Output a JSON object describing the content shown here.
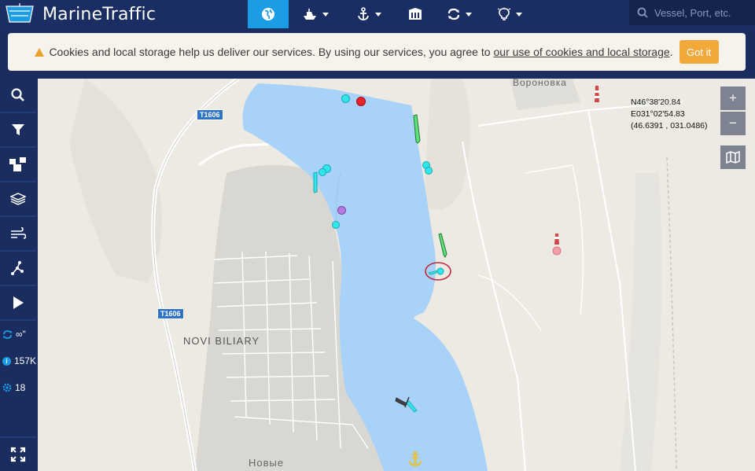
{
  "app": {
    "title": "MarineTraffic"
  },
  "nav": {
    "items": [
      {
        "id": "live-map",
        "icon": "globe-icon",
        "active": true,
        "caret": false
      },
      {
        "id": "ships",
        "icon": "ship-icon",
        "active": false,
        "caret": true
      },
      {
        "id": "ports",
        "icon": "anchor-icon",
        "active": false,
        "caret": true
      },
      {
        "id": "services",
        "icon": "building-icon",
        "active": false,
        "caret": false
      },
      {
        "id": "sync",
        "icon": "sync-icon",
        "active": false,
        "caret": true
      },
      {
        "id": "ideas",
        "icon": "lightbulb-icon",
        "active": false,
        "caret": true
      }
    ]
  },
  "search": {
    "placeholder": "Vessel, Port, etc."
  },
  "cookie": {
    "text": "Cookies and local storage help us deliver our services. By using our services, you agree to",
    "link": "our use of cookies and local storage",
    "end": ".",
    "button": "Got it"
  },
  "sidebar": {
    "buttons": [
      {
        "id": "search",
        "icon": "search-icon"
      },
      {
        "id": "filters",
        "icon": "filter-icon"
      },
      {
        "id": "fleets",
        "icon": "fleet-icon"
      },
      {
        "id": "layers",
        "icon": "layers-icon"
      },
      {
        "id": "weather",
        "icon": "wind-icon"
      },
      {
        "id": "measure",
        "icon": "measure-icon"
      },
      {
        "id": "playback",
        "icon": "play-icon"
      }
    ],
    "stats": [
      {
        "id": "refresh",
        "icon": "refresh-icon",
        "value": "∞\""
      },
      {
        "id": "vessels",
        "icon": "info-icon",
        "value": "157K"
      },
      {
        "id": "nearby",
        "icon": "gear-icon",
        "value": "18"
      }
    ],
    "fullscreen_icon": "fullscreen-icon"
  },
  "map": {
    "labels": {
      "voronovka": "Вороновка",
      "novi_biliary": "NOVI BILIARY",
      "novye": "Новые"
    },
    "road_shields": [
      "T1606",
      "T1606"
    ],
    "coordinates": {
      "lat": "N46°38'20.84",
      "lon": "E031°02'54.83",
      "decimal": "(46.6391 , 031.0486)"
    },
    "zoom": {
      "in": "+",
      "out": "−"
    },
    "colors": {
      "water": "#a8d2f7",
      "land": "#eceae3",
      "urban": "#dedcd6",
      "vessel_cyan": "#2fe6ec",
      "vessel_green": "#5fe07a",
      "vessel_red": "#e8222a",
      "vessel_purple": "#b37ae0",
      "vessel_pink": "#f4a0a8",
      "anchor": "#f0c020"
    }
  }
}
